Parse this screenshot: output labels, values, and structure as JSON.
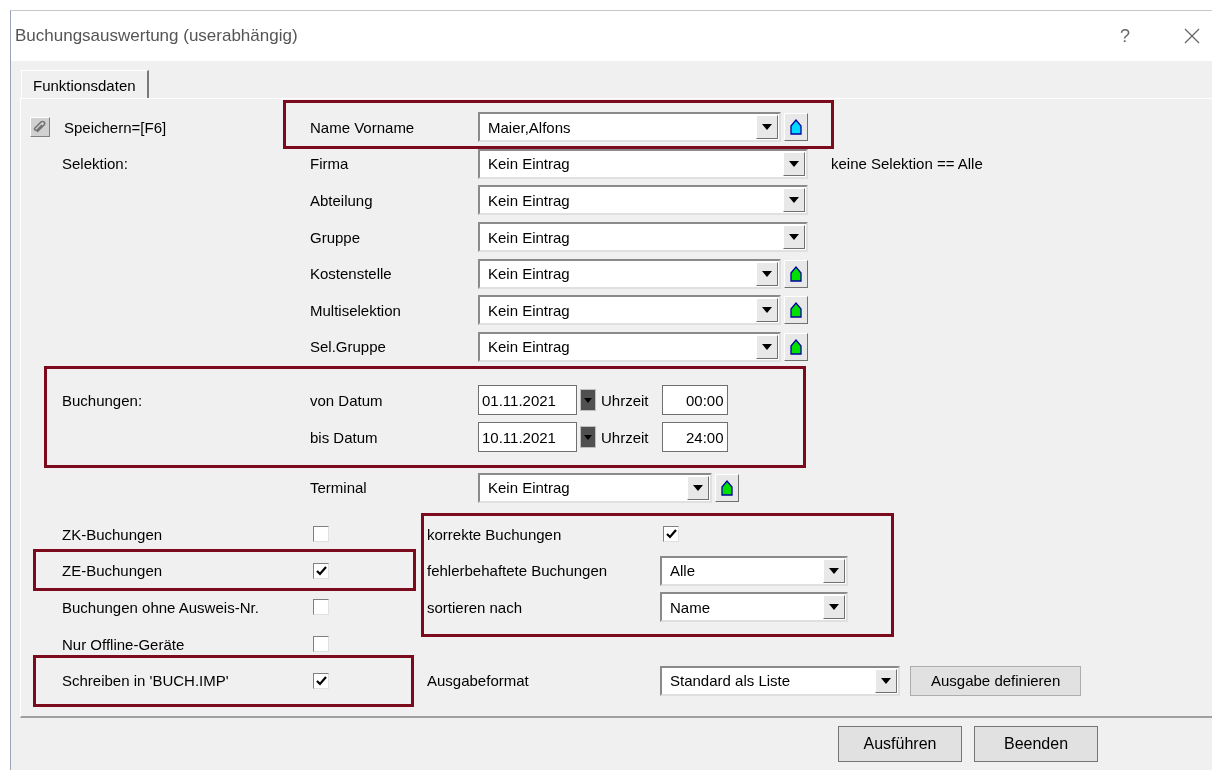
{
  "window": {
    "title": "Buchungsauswertung (userabhängig)",
    "help": "?"
  },
  "tabs": [
    {
      "label": "Funktionsdaten",
      "selected": true
    }
  ],
  "save": {
    "label": "Speichern=[F6]"
  },
  "selection": {
    "label": "Selektion:",
    "note": "keine Selektion == Alle",
    "fields": [
      {
        "label": "Name Vorname",
        "value": "Maier,Alfons",
        "lookup": true,
        "color": "#00d8ff"
      },
      {
        "label": "Firma",
        "value": "Kein Eintrag",
        "lookup": false
      },
      {
        "label": "Abteilung",
        "value": "Kein Eintrag",
        "lookup": false
      },
      {
        "label": "Gruppe",
        "value": "Kein Eintrag",
        "lookup": false
      },
      {
        "label": "Kostenstelle",
        "value": "Kein Eintrag",
        "lookup": true,
        "color": "#00e000"
      },
      {
        "label": "Multiselektion",
        "value": "Kein Eintrag",
        "lookup": true,
        "color": "#00e000"
      },
      {
        "label": "Sel.Gruppe",
        "value": "Kein Eintrag",
        "lookup": true,
        "color": "#00e000"
      }
    ]
  },
  "bookings": {
    "label": "Buchungen:",
    "ranges": [
      {
        "label": "von Datum",
        "date": "01.11.2021",
        "time_label": "Uhrzeit",
        "time": "00:00"
      },
      {
        "label": "bis Datum",
        "date": "10.11.2021",
        "time_label": "Uhrzeit",
        "time": "24:00"
      }
    ]
  },
  "terminal": {
    "label": "Terminal",
    "value": "Kein Eintrag",
    "lookup": true,
    "color": "#00e000"
  },
  "flags": [
    {
      "label": "ZK-Buchungen",
      "checked": false
    },
    {
      "label": "ZE-Buchungen",
      "checked": true
    },
    {
      "label": "Buchungen ohne Ausweis-Nr.",
      "checked": false
    },
    {
      "label": "Nur Offline-Geräte",
      "checked": false
    },
    {
      "label": "Schreiben in 'BUCH.IMP'",
      "checked": true
    }
  ],
  "filters": [
    {
      "kind": "checkbox",
      "label": "korrekte Buchungen",
      "checked": true
    },
    {
      "kind": "dropdown",
      "label": "fehlerbehaftete Buchungen",
      "value": "Alle"
    },
    {
      "kind": "dropdown",
      "label": "sortieren nach",
      "value": "Name"
    }
  ],
  "output": {
    "label": "Ausgabeformat",
    "value": "Standard als Liste",
    "button": "Ausgabe definieren"
  },
  "buttons": [
    "Ausführen",
    "Beenden"
  ]
}
